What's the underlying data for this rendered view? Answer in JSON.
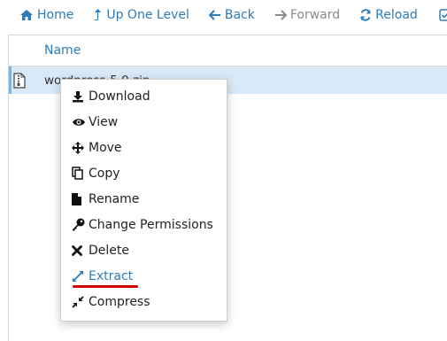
{
  "toolbar": {
    "home_label": "Home",
    "up_label": "Up One Level",
    "back_label": "Back",
    "forward_label": "Forward",
    "reload_label": "Reload"
  },
  "file_table": {
    "column_header": "Name",
    "rows": [
      {
        "name": "wordpress-5.0.zip",
        "icon": "zip-file-icon",
        "selected": true
      }
    ]
  },
  "context_menu": {
    "items": [
      {
        "label": "Download",
        "icon": "download-icon"
      },
      {
        "label": "View",
        "icon": "eye-icon"
      },
      {
        "label": "Move",
        "icon": "move-arrows-icon"
      },
      {
        "label": "Copy",
        "icon": "copy-icon"
      },
      {
        "label": "Rename",
        "icon": "file-icon"
      },
      {
        "label": "Change Permissions",
        "icon": "key-icon"
      },
      {
        "label": "Delete",
        "icon": "x-icon"
      },
      {
        "label": "Extract",
        "icon": "expand-icon",
        "highlighted": true
      },
      {
        "label": "Compress",
        "icon": "compress-icon"
      }
    ]
  },
  "colors": {
    "link_blue": "#2f7bb8",
    "selected_row": "#d8e9f7",
    "annotation_red": "#d40000"
  }
}
